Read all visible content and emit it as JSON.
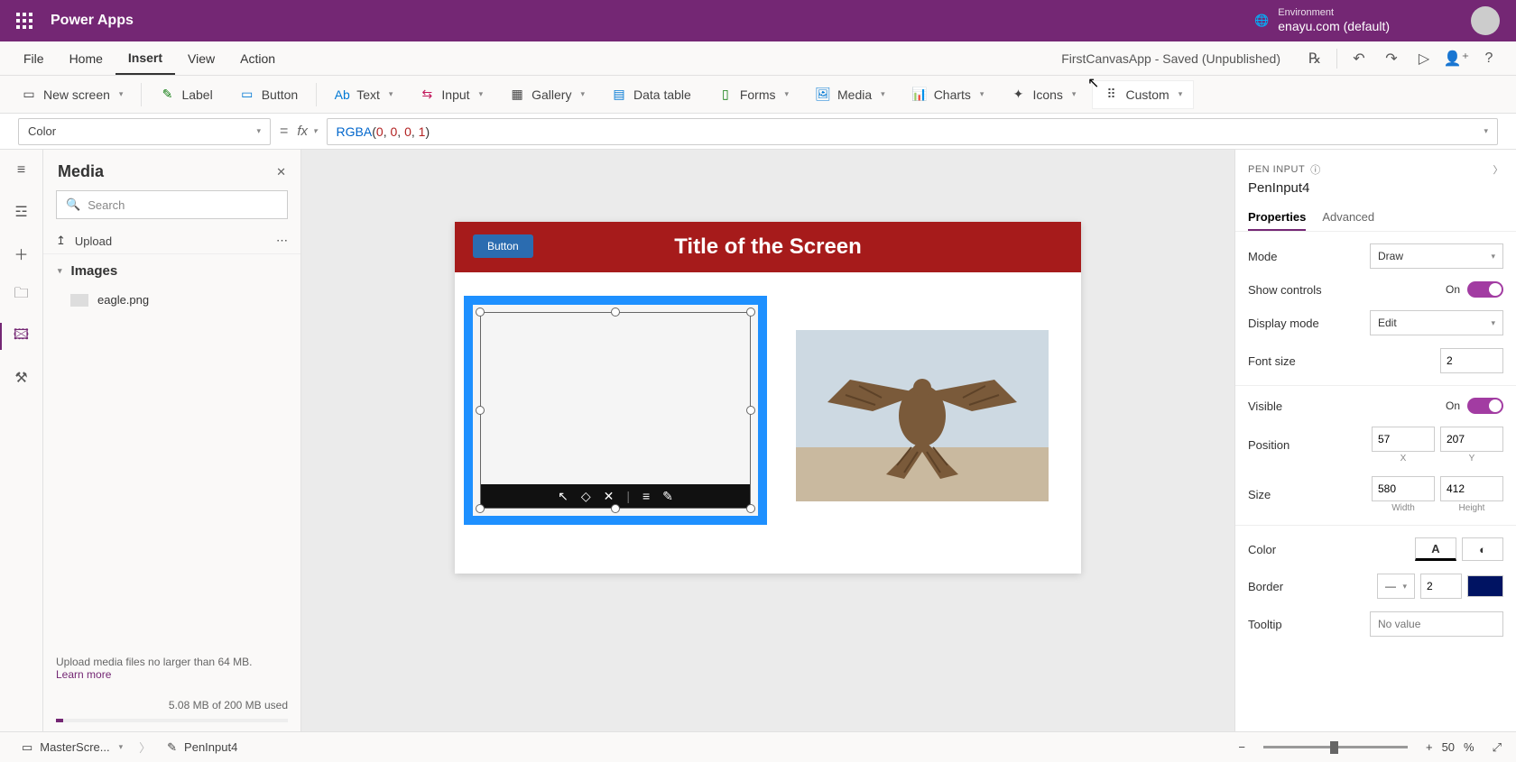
{
  "header": {
    "app_name": "Power Apps",
    "env_label": "Environment",
    "env_value": "enayu.com (default)"
  },
  "menu": {
    "file": "File",
    "home": "Home",
    "insert": "Insert",
    "view": "View",
    "action": "Action",
    "doc_title": "FirstCanvasApp - Saved (Unpublished)"
  },
  "ribbon": {
    "new_screen": "New screen",
    "label": "Label",
    "button": "Button",
    "text": "Text",
    "input": "Input",
    "gallery": "Gallery",
    "data_table": "Data table",
    "forms": "Forms",
    "media": "Media",
    "charts": "Charts",
    "icons": "Icons",
    "custom": "Custom"
  },
  "formula": {
    "property": "Color",
    "value_fn": "RGBA",
    "value_args": "(0, 0, 0, 1)"
  },
  "media_panel": {
    "title": "Media",
    "search_ph": "Search",
    "upload": "Upload",
    "images_hdr": "Images",
    "file1": "eagle.png",
    "hint": "Upload media files no larger than 64 MB.",
    "learn": "Learn more",
    "storage": "5.08 MB of 200 MB used"
  },
  "canvas": {
    "title": "Title of the Screen",
    "btn": "Button"
  },
  "props": {
    "type": "PEN INPUT",
    "name": "PenInput4",
    "tab_props": "Properties",
    "tab_adv": "Advanced",
    "mode": "Mode",
    "mode_v": "Draw",
    "show_ctrls": "Show controls",
    "show_ctrls_v": "On",
    "dispmode": "Display mode",
    "dispmode_v": "Edit",
    "fontsize": "Font size",
    "fontsize_v": "2",
    "visible": "Visible",
    "visible_v": "On",
    "position": "Position",
    "pos_x": "57",
    "pos_y": "207",
    "x_lbl": "X",
    "y_lbl": "Y",
    "size": "Size",
    "w": "580",
    "h": "412",
    "w_lbl": "Width",
    "h_lbl": "Height",
    "color": "Color",
    "border": "Border",
    "border_v": "2",
    "tooltip": "Tooltip",
    "tooltip_ph": "No value"
  },
  "footer": {
    "screen": "MasterScre...",
    "ctrl": "PenInput4",
    "zoom": "50",
    "pct": "%"
  }
}
